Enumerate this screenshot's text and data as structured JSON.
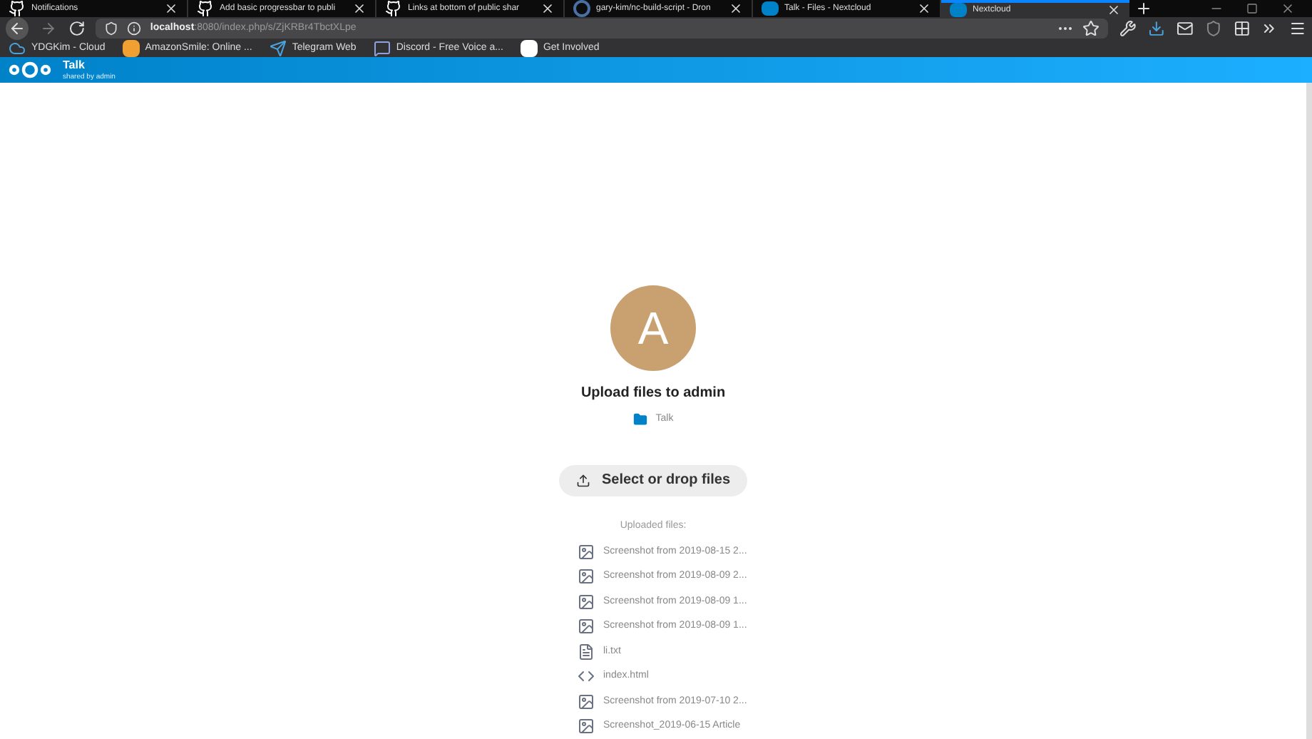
{
  "tabs": [
    {
      "label": "Notifications",
      "selected": false
    },
    {
      "label": "Add basic progressbar to publi",
      "selected": false
    },
    {
      "label": "Links at bottom of public shar",
      "selected": false
    },
    {
      "label": "gary-kim/nc-build-script - Dron",
      "selected": false
    },
    {
      "label": "Talk - Files - Nextcloud",
      "selected": false
    },
    {
      "label": "Nextcloud",
      "selected": true
    }
  ],
  "address_bar": {
    "url": "**localhost**:8080/index.php/s/ZjKRBr4TbctXLpe"
  },
  "bookmarks": [
    {
      "label": "YDGKim - Cloud"
    },
    {
      "label": "AmazonSmile: Online ..."
    },
    {
      "label": "Telegram Web"
    },
    {
      "label": "Discord - Free Voice a..."
    },
    {
      "label": "Get Involved"
    }
  ],
  "header": {
    "title": "Talk",
    "subtitle": "shared by admin"
  },
  "share": {
    "avatar_letter": "A",
    "title": "Upload files to admin",
    "folder": "Talk",
    "button": "Select or drop files",
    "uploaded_label": "Uploaded files:"
  },
  "files": [
    {
      "name": "Screenshot from 2019-08-15 2...",
      "kind": "image"
    },
    {
      "name": "Screenshot from 2019-08-09 2...",
      "kind": "image"
    },
    {
      "name": "Screenshot from 2019-08-09 1...",
      "kind": "image"
    },
    {
      "name": "Screenshot from 2019-08-09 1...",
      "kind": "image"
    },
    {
      "name": "li.txt",
      "kind": "text"
    },
    {
      "name": "index.html",
      "kind": "code"
    },
    {
      "name": "Screenshot from 2019-07-10 2...",
      "kind": "image"
    },
    {
      "name": "Screenshot_2019-06-15 Article",
      "kind": "image"
    }
  ]
}
